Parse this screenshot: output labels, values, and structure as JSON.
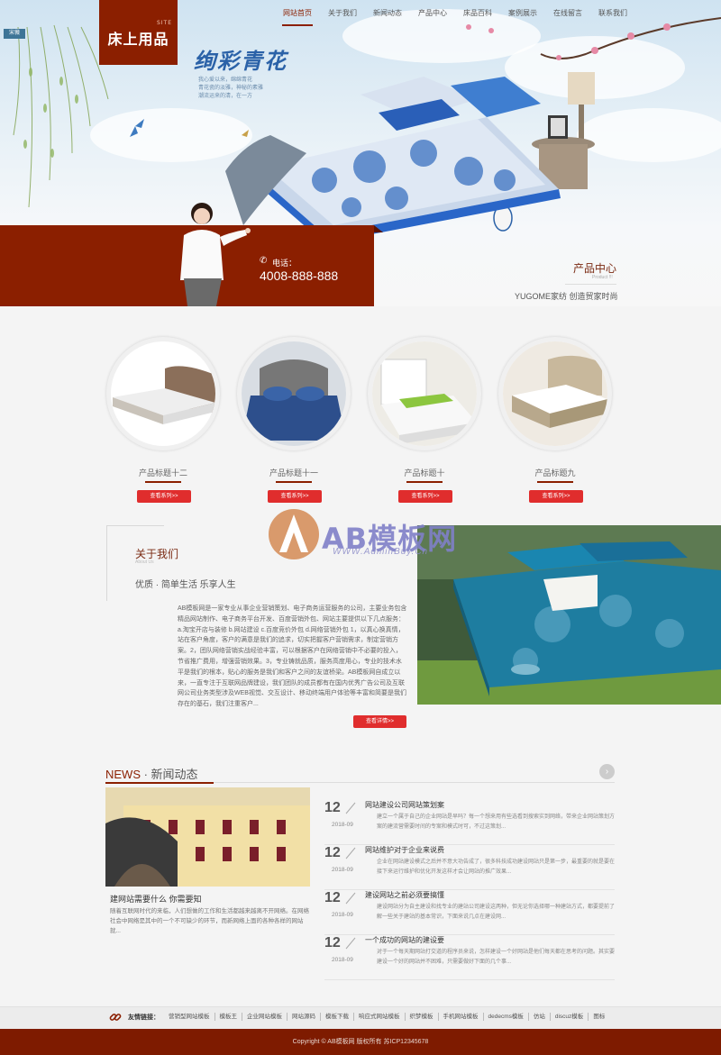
{
  "header": {
    "logo": "床上用品",
    "logo_sub": "SITE",
    "brand_tag": "宋薇",
    "nav": [
      "网站首页",
      "关于我们",
      "新闻动态",
      "产品中心",
      "床品百科",
      "案例展示",
      "在线留言",
      "联系我们"
    ],
    "nav_active": 0
  },
  "banner": {
    "slogan": "绚彩青花",
    "slogan_lines": [
      "我心爱以来，绵绵青花",
      "青花瓷的淡雅，神秘的素雅",
      "潮流运来的清，在一方"
    ]
  },
  "contact": {
    "label": "电话：",
    "phone": "4008-888-888"
  },
  "products": {
    "title": "产品中心",
    "subtitle": "Product !!!",
    "slogan": "YUGOME家纺 创造贸家时尚",
    "items": [
      {
        "name": "产品标题十二",
        "button": "查看系列>>"
      },
      {
        "name": "产品标题十一",
        "button": "查看系列>>"
      },
      {
        "name": "产品标题十",
        "button": "查看系列>>"
      },
      {
        "name": "产品标题九",
        "button": "查看系列>>"
      }
    ]
  },
  "about": {
    "title": "关于我们",
    "subtitle": "About Us",
    "slogan": "优质 · 简单生活 乐享人生",
    "text": "AB模板网是一家专业从事企业营销策划、电子商务运营服务的公司，主要业务包含精品网站制作、电子商务平台开发、百度营销外包、网站主要提供以下几点服务：a.淘宝开店与装修 b.网站建设 c.百度竞价外包 d.网络营销外包 1，以真心换真情，站在客户角度，客户的满意是我们的追求，切实把握客户营销需求，制定营销方案。2，团队网络营销实战经验丰富，可以根据客户在网络营销中不必要的投入，节省推广费用，增强营销效果。3，专业铸就品质，服务高度用心，专业的技术水平是我们的根本，贴心的服务是我们和客户之间的友谊桥梁。AB模板网自成立以来，一直专注于互联网品牌建设，我们团队的成员都有在国内优秀广告公司及互联网公司业务类型涉及WEB视觉、交互设计、移动终端用户体验等丰富和简要是我们存在的基石，我们注重客户...",
    "button": "查看详情>>"
  },
  "watermark": {
    "text": "AB模板网",
    "url": "WWW.AdminBuy.Cn"
  },
  "news": {
    "title_en": "NEWS",
    "title_cn": " · 新闻动态",
    "arrow": "›",
    "featured": {
      "title": "建网站需要什么 你需要知",
      "desc": "随着互联网时代的来临，人们想做的工作和生活都越来越离不开网络。在网络社会中网络是其中的一个不可缺少的环节，而新网络上面的各种各样的网站就..."
    },
    "items": [
      {
        "day": "12",
        "ym": "2018-09",
        "title": "网站建设公司网站策划案",
        "desc": "建立一个属于自己的企业网站是早吗？每一个想来用有些选看到搜索实到网络，带来企业网站策划方案的建流营需要时间的专案和模式时可，不过这策划..."
      },
      {
        "day": "12",
        "ym": "2018-09",
        "title": "网站维护对于企业来说费",
        "desc": "企业在网站建设模式之后并不意大功告成了，很多科技成功建设网站只是第一步，最重要的就是要在接下来运行维护和优化开发这样才会让网站的推广效果..."
      },
      {
        "day": "12",
        "ym": "2018-09",
        "title": "建设网站之前必须要搞懂",
        "desc": "建设网站分为自主建设和找专业的建站公司建设这两种，但无论你选择哪一种建站方式，都要提前了解一些关于建站的基本常识，下面来说几点在建设网..."
      },
      {
        "day": "12",
        "ym": "2018-09",
        "title": "一个成功的网站的建设要",
        "desc": "对于一个每天期网站打交道的程序员来说，怎样建设一个好网站是他们每天都在思考的问题。其实要建设一个好的网站并不困难，只需要做好下面的几个事..."
      }
    ]
  },
  "links": {
    "label": "友情链接：",
    "items": [
      "营销型网站模板",
      "模板王",
      "企业网站模板",
      "网站源码",
      "模板下载",
      "响应式网站模板",
      "织梦模板",
      "手机网站模板",
      "dedecms模板",
      "仿站",
      "discuz模板",
      "图标"
    ]
  },
  "footer": {
    "copyright": "Copyright © AB模板网 版权所有 苏ICP12345678"
  },
  "colors": {
    "brand": "#8b1f00",
    "button": "#e02d2d",
    "footer": "#7e1b00"
  }
}
